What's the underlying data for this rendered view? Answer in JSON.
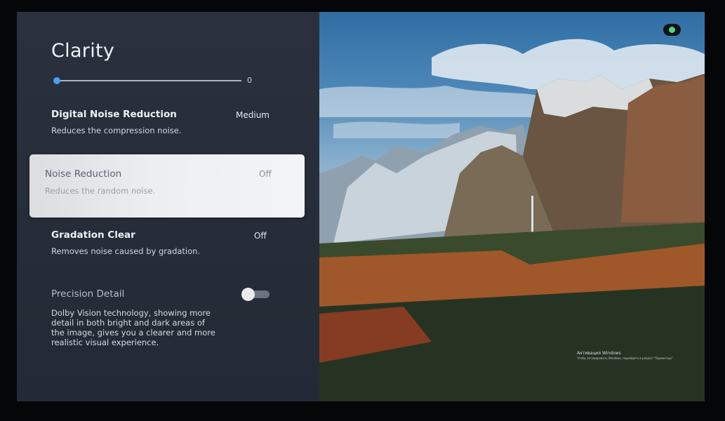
{
  "panel": {
    "title": "Clarity",
    "slider": {
      "value_text": "0",
      "value": 0
    },
    "items": [
      {
        "label": "Digital Noise Reduction",
        "value": "Medium",
        "desc": "Reduces the compression noise."
      },
      {
        "label": "Noise Reduction",
        "value": "Off",
        "desc": "Reduces the random noise."
      },
      {
        "label": "Gradation Clear",
        "value": "Off",
        "desc": "Removes noise caused by gradation."
      },
      {
        "label": "Precision Detail",
        "toggle": false,
        "desc": "Dolby Vision technology, showing more detail in both bright and dark areas of the image, gives you a clearer and more realistic visual experience."
      }
    ]
  },
  "overlay": {
    "watermark_title": "Активация Windows",
    "watermark_sub": "Чтобы активировать Windows, перейдите в раздел \"Параметры\"."
  },
  "colors": {
    "panel_bg": "#2a313d",
    "accent": "#4c9cff",
    "status_dot": "#53d776"
  }
}
